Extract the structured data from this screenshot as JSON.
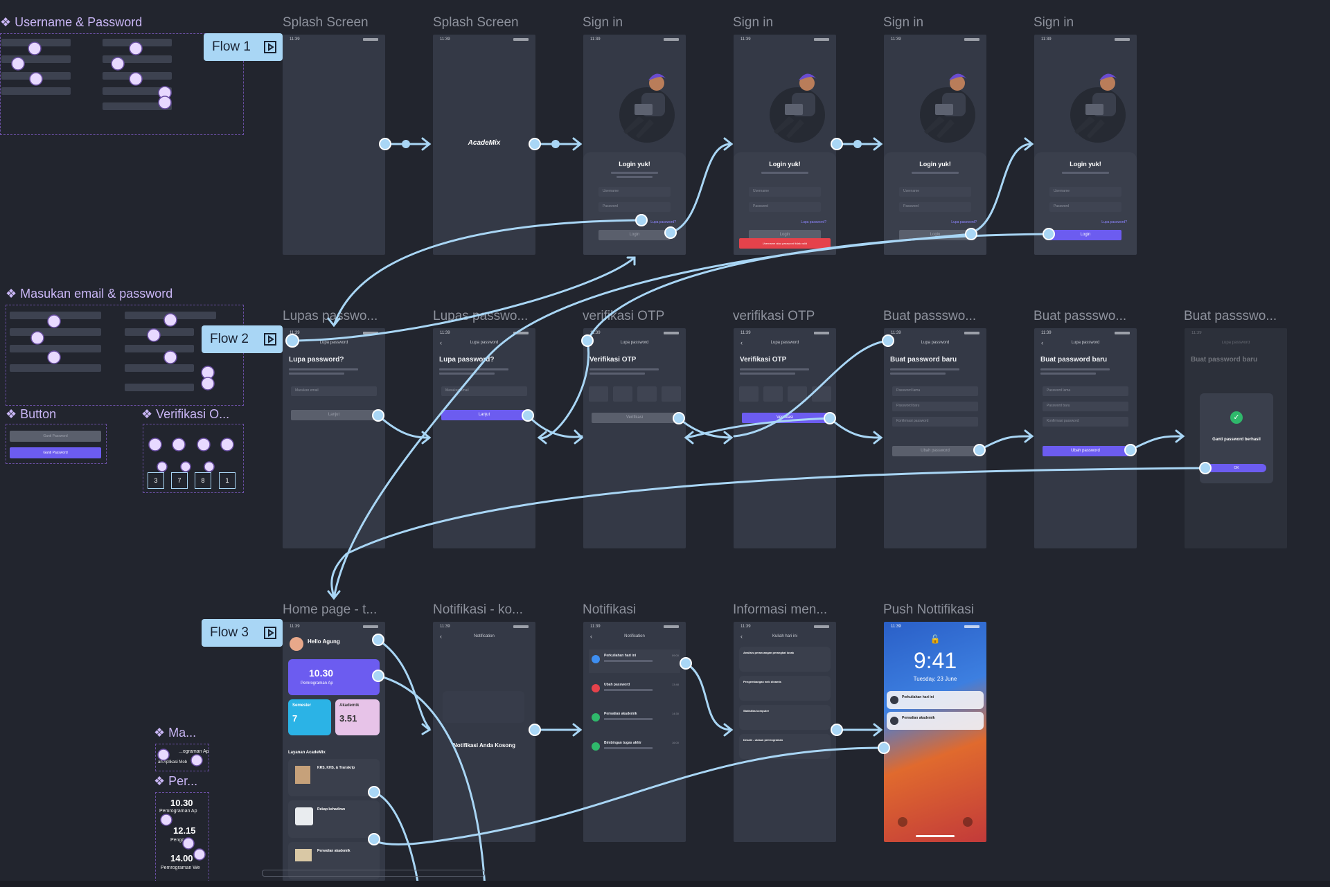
{
  "frames": {
    "row1": [
      "Splash Screen",
      "Splash Screen",
      "Sign in",
      "Sign in",
      "Sign in",
      "Sign in"
    ],
    "row2": [
      "Lupas passwo...",
      "Lupas passwo...",
      "verifikasi OTP",
      "verifikasi OTP",
      "Buat passswo...",
      "Buat passswo...",
      "Buat passswo..."
    ],
    "row3": [
      "Home page - t...",
      "Notifikasi - ko...",
      "Notifikasi",
      "Informasi men...",
      "Push Nottifikasi"
    ]
  },
  "flows": [
    "Flow 1",
    "Flow 2",
    "Flow 3"
  ],
  "components": {
    "username_password": "Username & Password",
    "email_password": "Masukan email & password",
    "button": "Button",
    "verifikasi": "Verifikasi O...",
    "ma": "Ma...",
    "per": "Per...",
    "otp_digits": [
      "3",
      "7",
      "8",
      "1"
    ],
    "mini_button_gray": "Ganti Password",
    "mini_button_purple": "Ganti Password",
    "per_times": [
      "10.30",
      "12.15",
      "14.00"
    ],
    "per_labels": [
      "Pemrograman Ap",
      "Pengo",
      "Pemrograman We"
    ],
    "ma_label1": "...ograman Ap",
    "ma_label2": "an Aplikasi Mob"
  },
  "status_time": "11:39",
  "splash_logo": "AcadeMix",
  "signin": {
    "title": "Login yuk!",
    "username": "Username",
    "password": "Password",
    "forgot": "Lupa password?",
    "login": "Login",
    "error": "Username atau password tidak valid"
  },
  "lupa": {
    "header": "Lupa password",
    "title": "Lupa password?",
    "email": "Masukan email",
    "button": "Lanjut"
  },
  "otp": {
    "header": "Lupa password",
    "title": "Verifikasi OTP",
    "button": "Verifikasi"
  },
  "buat": {
    "header": "Lupa password",
    "title": "Buat password baru",
    "f1": "Password lama",
    "f2": "Password baru",
    "f3": "Konfirmasi password",
    "button": "Ubah password",
    "success": "Ganti password berhasil",
    "ok": "OK"
  },
  "home": {
    "greeting": "Hello Agung",
    "time": "10.30",
    "course": "Pemrograman Ap",
    "semester_label": "Semester",
    "semester_value": "7",
    "akademik_label": "Akademik",
    "akademik_value": "3.51",
    "layanan": "Layanan AcadeMix",
    "service1": "KRS, KHS, & Transkrip",
    "service2": "Rekap kehadiran",
    "service3": "Perwalian akademik"
  },
  "notif_empty": {
    "header": "Notification",
    "title": "Notifikasi Anda Kosong"
  },
  "notif": {
    "header": "Notification",
    "items": [
      {
        "title": "Perkuliahan hari ini",
        "time": "09:00",
        "color": "#3e8ef0"
      },
      {
        "title": "Ubah password",
        "time": "13:48",
        "color": "#e5424b"
      },
      {
        "title": "Perwalian akademik",
        "time": "14:30",
        "color": "#2fb86b"
      },
      {
        "title": "Bimbingan tugas akhir",
        "time": "16:00",
        "color": "#2fb86b"
      }
    ]
  },
  "info": {
    "header": "Kuliah hari ini",
    "items": [
      "Analisis perancangan perangkat lunak",
      "Pengembangan web dinamis",
      "Statistika komputer",
      "Desain - ulasan pemrograman"
    ]
  },
  "push": {
    "time": "9:41",
    "date": "Tuesday, 23 June",
    "n1": "Perkuliahan hari ini",
    "n2": "Perwalian akademik"
  },
  "colors": {
    "canvas": "#22252e",
    "frame": "#343946",
    "accent": "#6c5cf0",
    "connector": "#a9d6f5",
    "error": "#e5424b",
    "component": "#c9b6f5"
  }
}
